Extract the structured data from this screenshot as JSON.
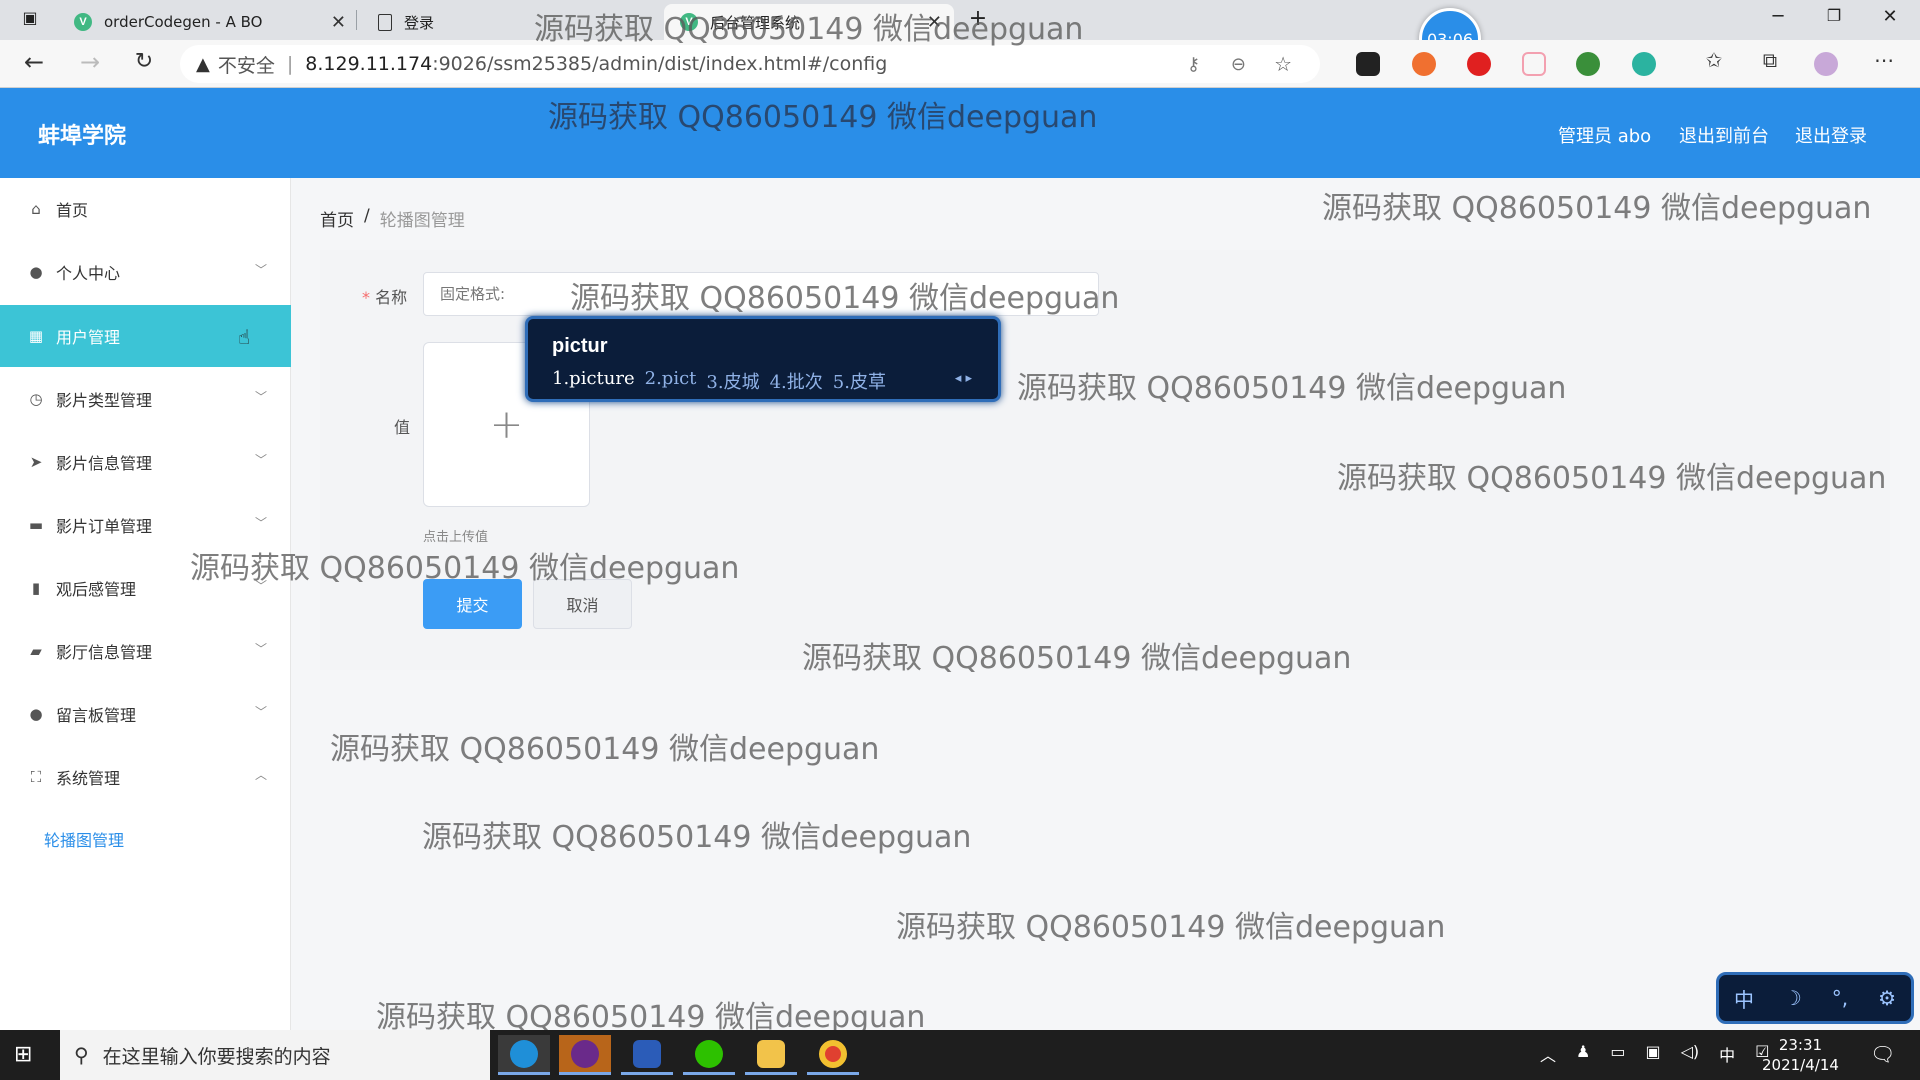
{
  "browser": {
    "tabs": [
      {
        "title": "orderCodegen - A BO",
        "icon": "vue-icon"
      },
      {
        "title": "登录",
        "icon": "page-icon"
      },
      {
        "title": "后台管理系统",
        "icon": "vue-icon"
      }
    ],
    "insecure_label": "不安全",
    "url_host": "8.129.11.174",
    "url_path": ":9026/ssm25385/admin/dist/index.html#/config",
    "timer": "03:06"
  },
  "header": {
    "brand": "蚌埠学院",
    "admin_label": "管理员 abo",
    "front_link": "退出到前台",
    "logout_link": "退出登录"
  },
  "sidebar": {
    "items": [
      {
        "label": "首页",
        "icon": "home-icon"
      },
      {
        "label": "个人中心",
        "icon": "user-icon"
      },
      {
        "label": "用户管理",
        "icon": "table-icon"
      },
      {
        "label": "影片类型管理",
        "icon": "clock-icon"
      },
      {
        "label": "影片信息管理",
        "icon": "send-icon"
      },
      {
        "label": "影片订单管理",
        "icon": "briefcase-icon"
      },
      {
        "label": "观后感管理",
        "icon": "bar-chart-icon"
      },
      {
        "label": "影厅信息管理",
        "icon": "chat-icon"
      },
      {
        "label": "留言板管理",
        "icon": "pin-icon"
      },
      {
        "label": "系统管理",
        "icon": "fullscreen-icon"
      }
    ],
    "sub_item": "轮播图管理"
  },
  "breadcrumb": {
    "home": "首页",
    "sep": "/",
    "current": "轮播图管理"
  },
  "form": {
    "name_label": "名称",
    "name_value": "固定格式: ",
    "value_label": "值",
    "upload_plus": "+",
    "upload_hint": "点击上传值",
    "submit": "提交",
    "cancel": "取消"
  },
  "ime": {
    "composition": "pictur",
    "candidates": [
      "1.picture",
      "2.pict",
      "3.皮城",
      "4.批次",
      "5.皮草"
    ],
    "toolbar": [
      "中",
      "☽",
      "°,",
      "⚙"
    ]
  },
  "watermark": "源码获取 QQ86050149 微信deepguan",
  "taskbar": {
    "search_placeholder": "在这里输入你要搜索的内容",
    "ime_indicator": "中",
    "time": "23:31",
    "date": "2021/4/14"
  }
}
